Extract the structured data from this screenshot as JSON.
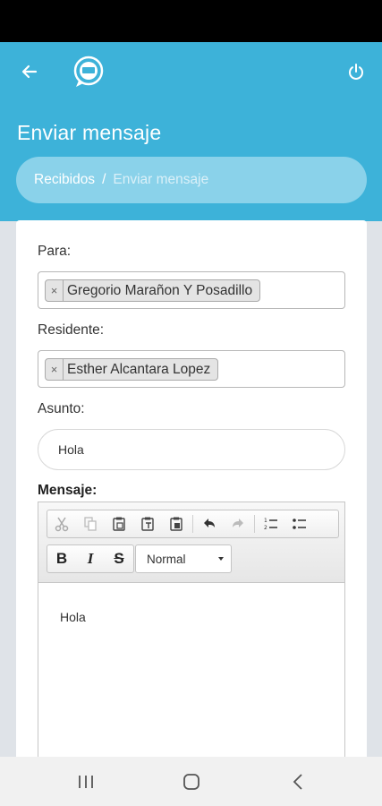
{
  "header": {
    "back_icon": "arrow-left-icon",
    "logo_icon": "chat-bubble-logo-icon",
    "power_icon": "power-icon"
  },
  "page": {
    "title": "Enviar mensaje"
  },
  "breadcrumb": {
    "parent": "Recibidos",
    "separator": "/",
    "current": "Enviar mensaje"
  },
  "form": {
    "to": {
      "label": "Para:",
      "chips": [
        "Gregorio Marañon Y Posadillo"
      ]
    },
    "resident": {
      "label": "Residente:",
      "chips": [
        "Esther Alcantara Lopez"
      ]
    },
    "subject": {
      "label": "Asunto:",
      "value": "Hola"
    },
    "message": {
      "label": "Mensaje:",
      "toolbar": {
        "row1": [
          "cut-icon",
          "copy-icon",
          "paste-icon",
          "paste-text-icon",
          "paste-word-icon",
          "undo-icon",
          "redo-icon",
          "numbered-list-icon",
          "bulleted-list-icon"
        ],
        "row2": [
          "bold-icon",
          "italic-icon",
          "strikethrough-icon"
        ],
        "format_value": "Normal",
        "bold_glyph": "B",
        "italic_glyph": "I",
        "strike_glyph": "S"
      },
      "body": "Hola"
    }
  },
  "chip_remove_glyph": "×",
  "colors": {
    "primary": "#3db2d9",
    "breadcrumb_bg": "#8ad2ea",
    "page_bg": "#dfe3e8"
  },
  "navbar": [
    "recent-apps-icon",
    "home-icon",
    "back-icon"
  ]
}
